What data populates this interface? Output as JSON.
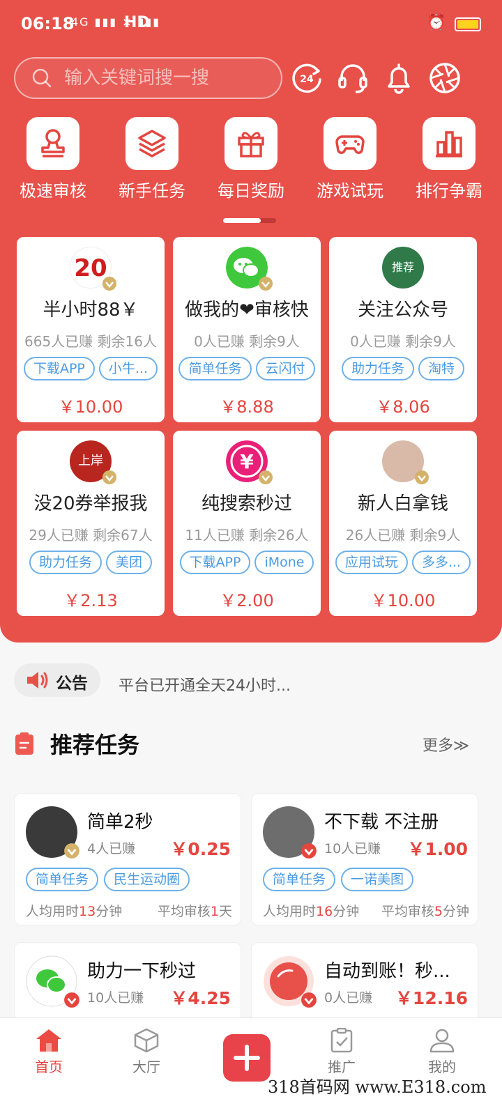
{
  "status_bar": {
    "time": "06:18",
    "signal": "4G ▮▮▮ × ▮▮▮",
    "network": "HD",
    "icons": [
      "alarm-icon",
      "battery-icon"
    ]
  },
  "header": {
    "search_placeholder": "输入关键词搜一搜",
    "icons": [
      "24h-service-icon",
      "headset-icon",
      "bell-icon",
      "aperture-icon"
    ]
  },
  "quick_actions": [
    {
      "label": "极速审核",
      "icon": "stamp-icon"
    },
    {
      "label": "新手任务",
      "icon": "layers-icon"
    },
    {
      "label": "每日奖励",
      "icon": "gift-icon"
    },
    {
      "label": "游戏试玩",
      "icon": "gamepad-icon"
    },
    {
      "label": "排行争霸",
      "icon": "bar-chart-icon"
    }
  ],
  "featured": [
    {
      "title": "半小时88￥",
      "earned": "665人已赚",
      "remaining": "剩余16人",
      "tags": [
        "下载APP",
        "小牛..."
      ],
      "price": "￥10.00",
      "avatar_text": "20",
      "avatar_color": "#ffffff"
    },
    {
      "title": "做我的❤审核快",
      "earned": "0人已赚",
      "remaining": "剩余9人",
      "tags": [
        "简单任务",
        "云闪付"
      ],
      "price": "￥8.88",
      "avatar_text": "…",
      "avatar_color": "#3fc83b"
    },
    {
      "title": "关注公众号",
      "earned": "0人已赚",
      "remaining": "剩余9人",
      "tags": [
        "助力任务",
        "淘特"
      ],
      "price": "￥8.06",
      "avatar_text": "推荐",
      "avatar_color": "#2f7a48"
    },
    {
      "title": "没20券举报我",
      "earned": "29人已赚",
      "remaining": "剩余67人",
      "tags": [
        "助力任务",
        "美团"
      ],
      "price": "￥2.13",
      "avatar_text": "上岸",
      "avatar_color": "#b8261f"
    },
    {
      "title": "纯搜索秒过",
      "earned": "11人已赚",
      "remaining": "剩余26人",
      "tags": [
        "下载APP",
        "iMone"
      ],
      "price": "￥2.00",
      "avatar_text": "￥",
      "avatar_color": "#ea1f78"
    },
    {
      "title": "新人白拿钱",
      "earned": "26人已赚",
      "remaining": "剩余9人",
      "tags": [
        "应用试玩",
        "多多..."
      ],
      "price": "￥10.00",
      "avatar_text": "",
      "avatar_color": "#d9b9a8"
    }
  ],
  "notice": {
    "label": "公告",
    "text": "平台已开通全天24小时..."
  },
  "recommended": {
    "title": "推荐任务",
    "more": "更多≫",
    "items": [
      {
        "title": "简单2秒",
        "earned": "4人已赚",
        "price": "￥0.25",
        "tags": [
          "简单任务",
          "民生运动圈"
        ],
        "avg_time_prefix": "人均用时",
        "avg_time_value": "13",
        "avg_time_unit": "分钟",
        "avg_review_prefix": "平均审核",
        "avg_review_value": "1",
        "avg_review_unit": "天",
        "avatar_color": "#3a3a3a"
      },
      {
        "title": "不下载 不注册",
        "earned": "10人已赚",
        "price": "￥1.00",
        "tags": [
          "简单任务",
          "一诺美图"
        ],
        "avg_time_prefix": "人均用时",
        "avg_time_value": "16",
        "avg_time_unit": "分钟",
        "avg_review_prefix": "平均审核",
        "avg_review_value": "5",
        "avg_review_unit": "分钟",
        "avatar_color": "#6d6d6d"
      },
      {
        "title": "助力一下秒过",
        "earned": "10人已赚",
        "price": "￥4.25",
        "tags": [],
        "avatar_color": "#3fc83b"
      },
      {
        "title": "自动到账！秒...",
        "earned": "0人已赚",
        "price": "￥12.16",
        "tags": [],
        "avatar_color": "#e8504a"
      }
    ]
  },
  "tab_bar": [
    {
      "label": "首页",
      "icon": "home-icon",
      "active": true
    },
    {
      "label": "大厅",
      "icon": "cube-icon",
      "active": false
    },
    {
      "label": "",
      "icon": "plus-icon",
      "active": false
    },
    {
      "label": "推广",
      "icon": "clipboard-check-icon",
      "active": false
    },
    {
      "label": "我的",
      "icon": "user-icon",
      "active": false
    }
  ],
  "watermark": "318首码网 www.E318.com",
  "colors": {
    "brand_red": "#e8504a",
    "price_red": "#e4453f",
    "tag_blue": "#4a9be0",
    "battery_yellow": "#ffd21f"
  }
}
